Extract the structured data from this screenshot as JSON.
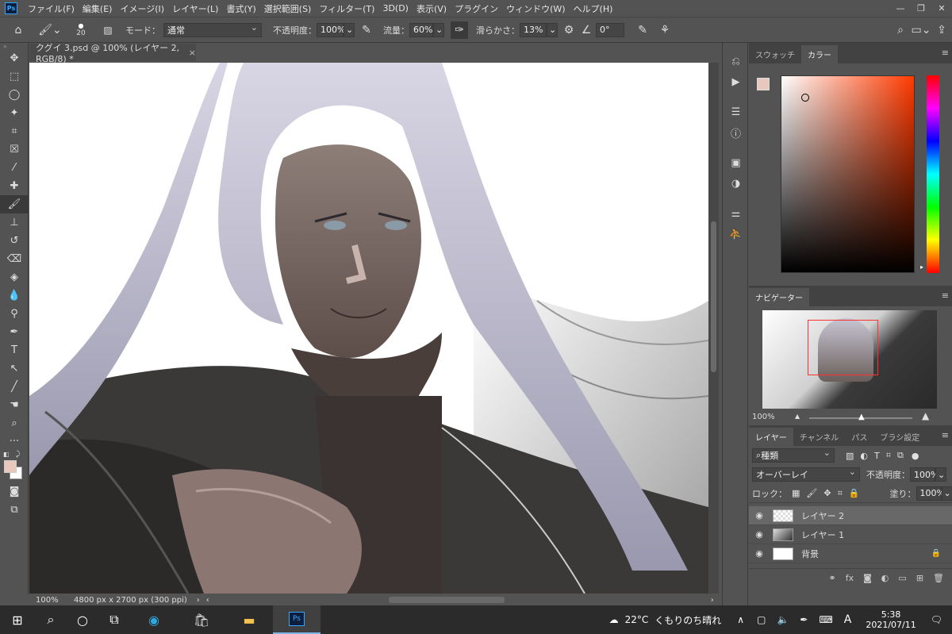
{
  "menubar": {
    "app_icon": "Ps",
    "items": [
      "ファイル(F)",
      "編集(E)",
      "イメージ(I)",
      "レイヤー(L)",
      "書式(Y)",
      "選択範囲(S)",
      "フィルター(T)",
      "3D(D)",
      "表示(V)",
      "プラグイン",
      "ウィンドウ(W)",
      "ヘルプ(H)"
    ]
  },
  "optionsbar": {
    "brush_size": "20",
    "mode_label": "モード：",
    "mode_value": "通常",
    "opacity_label": "不透明度：",
    "opacity_value": "100%",
    "flow_label": "流量：",
    "flow_value": "60%",
    "smoothing_label": "滑らかさ：",
    "smoothing_value": "13%",
    "angle_value": "0°"
  },
  "document": {
    "tab_title": "クグイ 3.psd @ 100% (レイヤー 2, RGB/8) *",
    "zoom": "100%",
    "info": "4800 px x 2700 px (300 ppi)"
  },
  "color_panel": {
    "tabs": [
      "スウォッチ",
      "カラー"
    ],
    "fg_color": "#e8c8bd",
    "hue_color": "#ff3a00"
  },
  "navigator_panel": {
    "tab": "ナビゲーター",
    "zoom": "100%"
  },
  "layers_panel": {
    "tabs": [
      "レイヤー",
      "チャンネル",
      "パス",
      "ブラシ設定"
    ],
    "filter_label": "種類",
    "blend_mode": "オーバーレイ",
    "opacity_label": "不透明度：",
    "opacity_value": "100%",
    "lock_label": "ロック：",
    "fill_label": "塗り：",
    "fill_value": "100%",
    "layers": [
      {
        "name": "レイヤー 2",
        "selected": true
      },
      {
        "name": "レイヤー 1",
        "selected": false
      },
      {
        "name": "背景",
        "selected": false,
        "locked": true
      }
    ]
  },
  "taskbar": {
    "weather_temp": "22°C",
    "weather_desc": "くもりのち晴れ",
    "ime": "A",
    "time": "5:38",
    "date": "2021/07/11"
  }
}
